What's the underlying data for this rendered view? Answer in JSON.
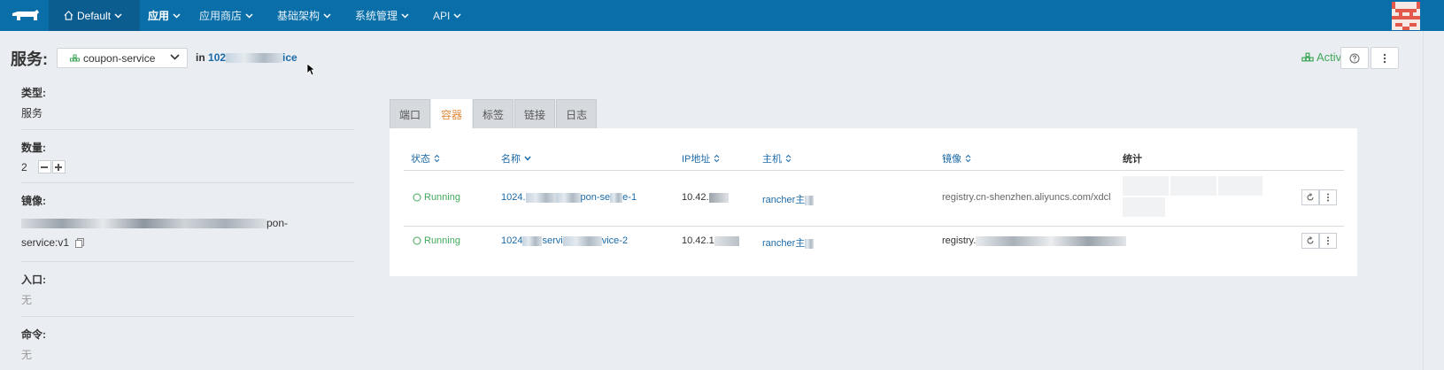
{
  "nav": {
    "environment": "Default",
    "items": [
      {
        "label": "应用",
        "active": true
      },
      {
        "label": "应用商店",
        "active": false
      },
      {
        "label": "基础架构",
        "active": false
      },
      {
        "label": "系统管理",
        "active": false
      },
      {
        "label": "API",
        "active": false
      }
    ]
  },
  "header": {
    "title": "服务:",
    "service_selected": "coupon-service",
    "in_prefix": "in",
    "stack_name_start": "102",
    "stack_name_end": "ice",
    "state": "Active"
  },
  "details": {
    "type_label": "类型:",
    "type_value": "服务",
    "scale_label": "数量:",
    "scale_value": "2",
    "image_label": "镜像:",
    "image_value_tail": "pon-",
    "image_value_line2": "service:v1",
    "ports_label": "入口:",
    "ports_value": "无",
    "command_label": "命令:",
    "command_value": "无"
  },
  "tabs": [
    {
      "label": "端口",
      "active": false
    },
    {
      "label": "容器",
      "active": true
    },
    {
      "label": "标签",
      "active": false
    },
    {
      "label": "链接",
      "active": false
    },
    {
      "label": "日志",
      "active": false
    }
  ],
  "table": {
    "headers": {
      "state": "状态",
      "name": "名称",
      "ip": "IP地址",
      "host": "主机",
      "image": "镜像",
      "stats": "统计"
    },
    "rows": [
      {
        "state": "Running",
        "name_start": "1024.",
        "name_mid": "pon-se",
        "name_end": "e-1",
        "ip_start": "10.42.",
        "host": "rancher主",
        "image_start": "registry.cn-shenzhen.aliyuncs.com/xdcl"
      },
      {
        "state": "Running",
        "name_start": "1024",
        "name_mid": "servi",
        "name_end": "vice-2",
        "ip_start": "10.42.1",
        "host": "rancher主",
        "image_start": "registry."
      }
    ]
  },
  "colors": {
    "nav_bg": "#0a6fa9",
    "nav_active_bg": "#0c5d8f",
    "link": "#1b6aa8",
    "running": "#41a85b",
    "active_tab": "#e08a3a"
  }
}
